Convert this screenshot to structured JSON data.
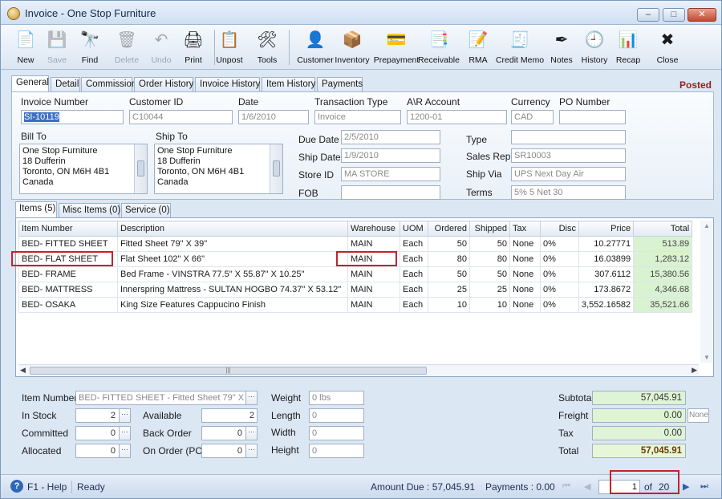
{
  "window": {
    "title": "Invoice - One Stop Furniture",
    "minimize": "–",
    "maximize": "□",
    "close": "✕"
  },
  "toolbar": [
    {
      "label": "New",
      "icon": "new-document-icon",
      "glyph": "📄",
      "enabled": true
    },
    {
      "label": "Save",
      "icon": "save-disk-icon",
      "glyph": "💾",
      "enabled": false
    },
    {
      "label": "Find",
      "icon": "binoculars-icon",
      "glyph": "🔭",
      "enabled": true
    },
    {
      "label": "Delete",
      "icon": "trash-icon",
      "glyph": "🗑",
      "enabled": false
    },
    {
      "label": "Undo",
      "icon": "undo-icon",
      "glyph": "↶",
      "enabled": false
    },
    {
      "label": "Print",
      "icon": "printer-icon",
      "glyph": "🖨",
      "enabled": true
    },
    {
      "label": "Unpost",
      "icon": "unpost-icon",
      "glyph": "📋",
      "enabled": true
    },
    {
      "label": "Tools",
      "icon": "tools-icon",
      "glyph": "🛠",
      "enabled": true
    },
    {
      "label": "Customer",
      "icon": "customer-icon",
      "glyph": "👤",
      "enabled": true
    },
    {
      "label": "Inventory",
      "icon": "inventory-boxes-icon",
      "glyph": "📦",
      "enabled": true
    },
    {
      "label": "Prepayment",
      "icon": "prepayment-icon",
      "glyph": "💳",
      "enabled": true
    },
    {
      "label": "Receivable",
      "icon": "receivable-icon",
      "glyph": "📑",
      "enabled": true
    },
    {
      "label": "RMA",
      "icon": "rma-icon",
      "glyph": "📝",
      "enabled": true
    },
    {
      "label": "Credit Memo",
      "icon": "credit-memo-icon",
      "glyph": "🧾",
      "enabled": true
    },
    {
      "label": "Notes",
      "icon": "notes-pen-icon",
      "glyph": "✒",
      "enabled": true
    },
    {
      "label": "History",
      "icon": "history-icon",
      "glyph": "🕘",
      "enabled": true
    },
    {
      "label": "Recap",
      "icon": "recap-icon",
      "glyph": "📊",
      "enabled": true
    },
    {
      "label": "Close",
      "icon": "close-form-icon",
      "glyph": "✖",
      "enabled": true
    }
  ],
  "status": "Posted",
  "tabs": [
    "General",
    "Detail",
    "Commission",
    "Order History",
    "Invoice History",
    "Item History",
    "Payments"
  ],
  "general": {
    "invoice_number_label": "Invoice Number",
    "invoice_number": "SI-10119",
    "customer_id_label": "Customer ID",
    "customer_id": "C10044",
    "date_label": "Date",
    "date": "1/6/2010",
    "transaction_type_label": "Transaction Type",
    "transaction_type": "Invoice",
    "ar_account_label": "A\\R Account",
    "ar_account": "1200-01",
    "currency_label": "Currency",
    "currency": "CAD",
    "po_number_label": "PO Number",
    "po_number": "",
    "bill_to_label": "Bill To",
    "bill_to": [
      "One Stop Furniture",
      "18 Dufferin",
      "Toronto, ON M6H 4B1",
      "Canada"
    ],
    "ship_to_label": "Ship To",
    "ship_to": [
      "One Stop Furniture",
      "18 Dufferin",
      "Toronto, ON M6H 4B1",
      "Canada"
    ],
    "due_date_label": "Due Date",
    "due_date": "2/5/2010",
    "ship_date_label": "Ship Date",
    "ship_date": "1/9/2010",
    "store_id_label": "Store ID",
    "store_id": "MA STORE",
    "fob_label": "FOB",
    "fob": "",
    "type_label": "Type",
    "type": "",
    "sales_rep_label": "Sales Rep",
    "sales_rep": "SR10003",
    "ship_via_label": "Ship Via",
    "ship_via": "UPS Next Day Air",
    "terms_label": "Terms",
    "terms": "5% 5 Net 30"
  },
  "subtabs": [
    "Items (5)",
    "Misc Items (0)",
    "Service (0)"
  ],
  "grid": {
    "columns": [
      "Item Number",
      "Description",
      "Warehouse",
      "UOM",
      "Ordered",
      "Shipped",
      "Tax",
      "Disc",
      "Price",
      "Total"
    ],
    "rows": [
      [
        "BED- FITTED SHEET",
        "Fitted Sheet 79\" X 39\"",
        "MAIN",
        "Each",
        "50",
        "50",
        "None",
        "0%",
        "10.27771",
        "513.89"
      ],
      [
        "BED- FLAT SHEET",
        "Flat Sheet 102\" X 66\"",
        "MAIN",
        "Each",
        "80",
        "80",
        "None",
        "0%",
        "16.03899",
        "1,283.12"
      ],
      [
        "BED- FRAME",
        "Bed Frame - VINSTRA 77.5\" X 55.87\" X 10.25\"",
        "MAIN",
        "Each",
        "50",
        "50",
        "None",
        "0%",
        "307.6112",
        "15,380.56"
      ],
      [
        "BED- MATTRESS",
        "Innerspring Mattress - SULTAN HOGBO 74.37\" X 53.12\"",
        "MAIN",
        "Each",
        "25",
        "25",
        "None",
        "0%",
        "173.8672",
        "4,346.68"
      ],
      [
        "BED- OSAKA",
        "King Size Features Cappucino Finish",
        "MAIN",
        "Each",
        "10",
        "10",
        "None",
        "0%",
        "3,552.16582",
        "35,521.66"
      ]
    ]
  },
  "detail": {
    "item_number_label": "Item Number",
    "item_number": "BED- FITTED SHEET - Fitted Sheet 79\" X 39\"",
    "in_stock_label": "In Stock",
    "in_stock": "2",
    "available_label": "Available",
    "available": "2",
    "committed_label": "Committed",
    "committed": "0",
    "back_order_label": "Back Order",
    "back_order": "0",
    "allocated_label": "Allocated",
    "allocated": "0",
    "on_order_label": "On Order (PO)",
    "on_order": "0",
    "weight_label": "Weight",
    "weight": "0 lbs",
    "length_label": "Length",
    "length": "0",
    "width_label": "Width",
    "width": "0",
    "height_label": "Height",
    "height": "0",
    "ellipsis": "···"
  },
  "summary": {
    "subtotal_label": "Subtotal",
    "subtotal": "57,045.91",
    "freight_label": "Freight",
    "freight": "0.00",
    "freight_tax": "None",
    "tax_label": "Tax",
    "tax": "0.00",
    "total_label": "Total",
    "total": "57,045.91"
  },
  "statusbar": {
    "help": "F1 - Help",
    "state": "Ready",
    "amount_due": "Amount Due : 57,045.91",
    "payments": "Payments : 0.00",
    "page": "1",
    "of": "of",
    "total_pages": "20",
    "first": "⏮",
    "prev": "◀",
    "next": "▶",
    "last": "⏭"
  },
  "colors": {
    "posted": "#9b1b1b",
    "highlight_box": "#c3232b",
    "total_cell": "#d9f2d2"
  }
}
